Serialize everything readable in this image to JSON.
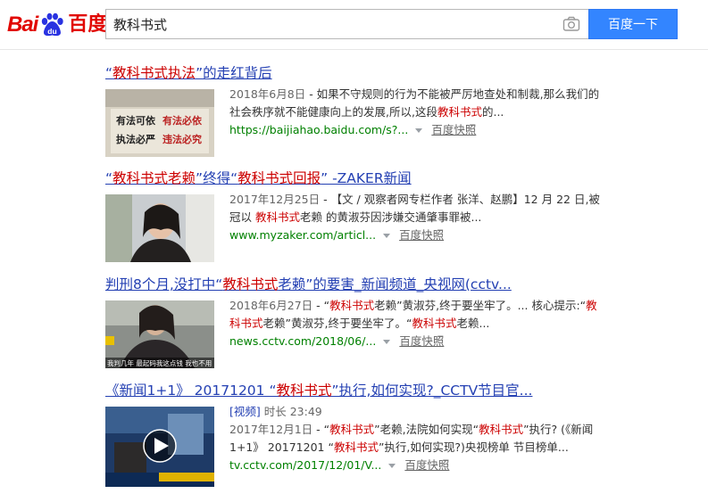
{
  "logo": {
    "text_latin": "Bai",
    "text_cn": "百度"
  },
  "search": {
    "query": "教科书式",
    "button_label": "百度一下"
  },
  "results": [
    {
      "title_parts": [
        "“",
        "教科书式",
        "执法",
        "”的走红背后"
      ],
      "meta_date": "2018年6月8日",
      "snippet_a": " - 如果不守规则的行为不能被严厉地查处和制裁,那么我们的社会秩序就不能健康向上的发展,所以,这段",
      "snippet_em": "教科书式",
      "snippet_b": "的...",
      "source": "https://baijiahao.baidu.com/s?...",
      "cache_label": "百度快照",
      "thumb_text": [
        "有法可依",
        "有法必依",
        "执法必严",
        "违法必究"
      ]
    },
    {
      "title_parts": [
        "“",
        "教科书式老赖",
        "”终得“",
        "教科书式回报",
        "” -ZAKER新闻"
      ],
      "meta_date": "2017年12月25日",
      "snippet_a": " - 【文 / 观察者网专栏作者 张洋、赵鹏】12 月 22 日,被冠以 ",
      "snippet_em": "教科书式",
      "snippet_b": "老赖 的黄淑芬因涉嫌交通肇事罪被...",
      "source": "www.myzaker.com/articl...",
      "cache_label": "百度快照"
    },
    {
      "title_parts": [
        "判刑8个月,没打中“",
        "教科书式",
        "老赖”的要害_新闻频道_央视网(cctv..."
      ],
      "meta_date": "2018年6月27日",
      "snippet_a": " - “",
      "snippet_em": "教科书式",
      "snippet_b": "老赖”黄淑芬,终于要坐牢了。... 核心提示:“",
      "snippet_em2": "教科书式",
      "snippet_c": "老赖”黄淑芬,终于要坐牢了。“",
      "snippet_em3": "教科书式",
      "snippet_d": "老赖...",
      "source": "news.cctv.com/2018/06/...",
      "cache_label": "百度快照",
      "thumb_caption": "我判几年 最起码我这点钱 我也不用"
    },
    {
      "title_parts": [
        "《新闻1+1》 20171201 “",
        "教科书式",
        "”执行,如何实现?_CCTV节目官..."
      ],
      "video_tag": "[视频]",
      "duration": "时长 23:49",
      "meta_date": "2017年12月1日",
      "snippet_a": " - “",
      "snippet_em": "教科书式",
      "snippet_b": "”老赖,法院如何实现“",
      "snippet_em2": "教科书式",
      "snippet_c": "”执行? (《新闻1+1》 20171201 “",
      "snippet_em3": "教科书式",
      "snippet_d": "”执行,如何实现?)央视榜单 节目榜单...",
      "source": "tv.cctv.com/2017/12/01/V...",
      "cache_label": "百度快照"
    }
  ],
  "colors": {
    "brand_red": "#e10601",
    "link_blue": "#2440b3",
    "highlight_red": "#cc0000",
    "url_green": "#008000",
    "button_blue": "#3385ff"
  }
}
